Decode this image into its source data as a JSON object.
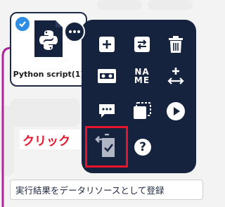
{
  "node": {
    "label": "Python script(1)",
    "icon": "python-file-icon",
    "checked": true
  },
  "menu": {
    "more_icon": "more-horizontal-icon",
    "items": [
      {
        "icon": "plus-icon"
      },
      {
        "icon": "swap-arrows-icon"
      },
      {
        "icon": "trash-icon"
      },
      {
        "icon": "tape-icon"
      },
      {
        "icon": "name-text-icon",
        "text_line1": "NA",
        "text_line2": "ME"
      },
      {
        "icon": "plus-arrow-icon"
      },
      {
        "icon": "comment-icon"
      },
      {
        "icon": "dashed-frame-icon"
      },
      {
        "icon": "play-icon"
      },
      {
        "icon": "export-result-icon"
      },
      {
        "icon": "help-icon",
        "text": "?"
      }
    ]
  },
  "annotation": {
    "click_label": "クリック",
    "color": "#e8122a"
  },
  "tooltip": {
    "text": "実行結果をデータリソースとして登録"
  },
  "colors": {
    "panel": "#16233f",
    "connector": "#b0239a",
    "check": "#2f8ee3"
  }
}
